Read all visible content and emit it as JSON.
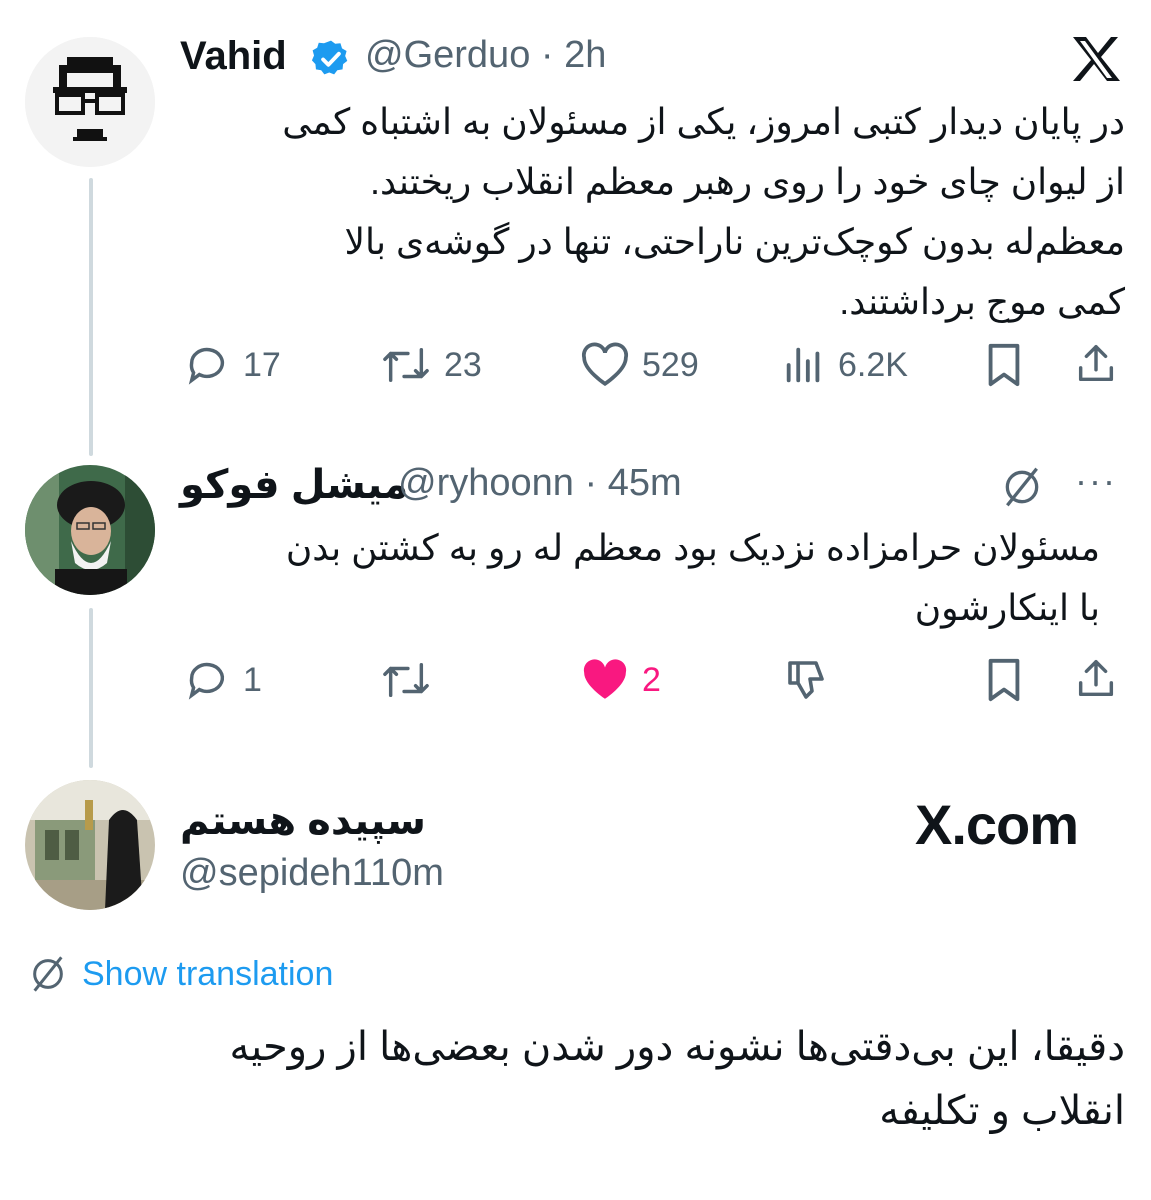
{
  "tweet1": {
    "name": "Vahid",
    "handle": "@Gerduo",
    "time": "2h",
    "lines": [
      "در پایان دیدار کتبی امروز، یکی از مسئولان به اشتباه کمی",
      "از لیوان چای خود را روی رهبر معظم انقلاب ریختند.",
      "معظم‌له بدون کوچک‌ترین ناراحتی، تنها در گوشه‌ی بالا",
      "کمی موج برداشتند."
    ],
    "replies": "17",
    "reposts": "23",
    "likes": "529",
    "views": "6.2K"
  },
  "tweet2": {
    "name": "میشل فوکو",
    "handle": "@ryhoonn",
    "time": "45m",
    "more": "···",
    "lines": [
      "مسئولان حرامزاده نزدیک بود معظم له رو به کشتن بدن",
      "با اینکارشون"
    ],
    "replies": "1",
    "likes": "2"
  },
  "tweet3": {
    "name": "سپیده هستم",
    "handle": "@sepideh110m",
    "show_translation": "Show translation",
    "lines": [
      "دقیقا، این بی‌دقتی‌ها نشونه دور شدن بعضی‌ها از روحیه",
      "انقلاب و تکلیفه"
    ]
  },
  "branding": {
    "xcom": "X.com"
  },
  "colors": {
    "accent": "#1d9bf0",
    "like": "#f91880",
    "muted": "#536471"
  }
}
